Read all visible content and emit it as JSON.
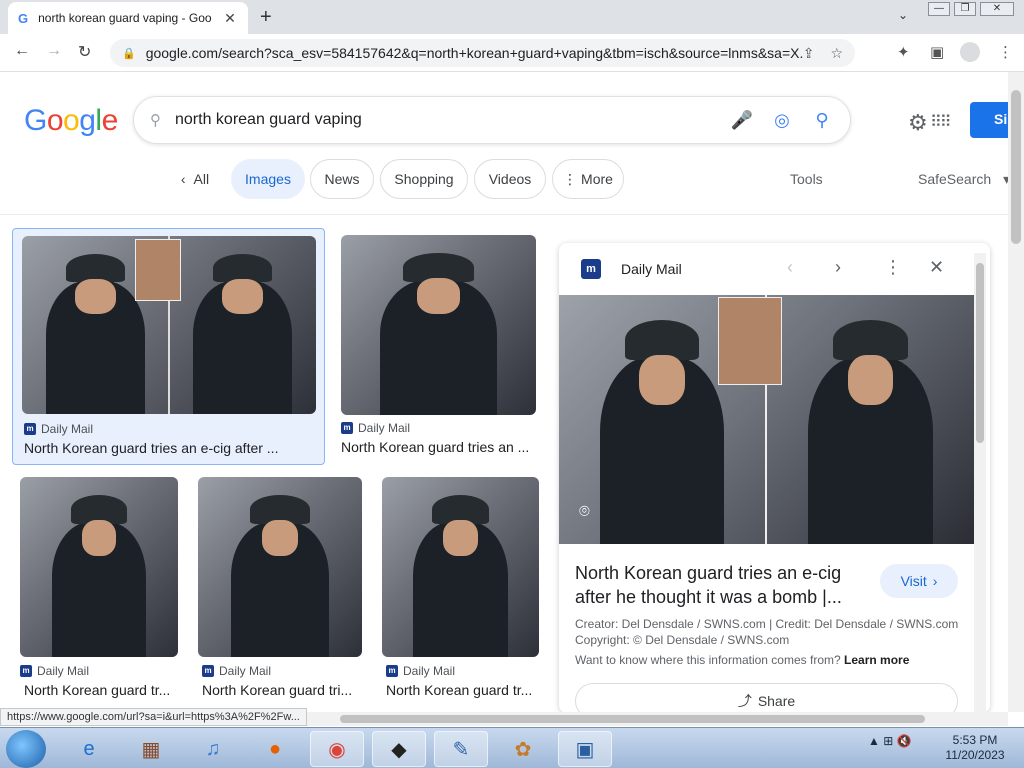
{
  "browser": {
    "tab_title": "north korean guard vaping - Goo",
    "tab_favicon": "G",
    "tab_close": "✕",
    "new_tab": "+",
    "tab_list": "⌄",
    "url": "google.com/search?sca_esv=584157642&q=north+korean+guard+vaping&tbm=isch&source=lnms&sa=X...",
    "status_url": "https://www.google.com/url?sa=i&url=https%3A%2F%2Fw...",
    "win_min": "—",
    "win_restore": "❐",
    "win_close": "✕"
  },
  "search": {
    "logo": "Google",
    "query": "north korean guard vaping",
    "signin": "Si",
    "search_icon": "🔍",
    "mic_icon": "🎙",
    "lens_icon": "◎"
  },
  "chips": {
    "all": "All",
    "images": "Images",
    "news": "News",
    "shopping": "Shopping",
    "videos": "Videos",
    "more": "More",
    "tools": "Tools",
    "safesearch": "SafeSearch"
  },
  "results": [
    {
      "source": "Daily Mail",
      "title": "North Korean guard tries an e-cig after ..."
    },
    {
      "source": "Daily Mail",
      "title": "North Korean guard tries an ..."
    },
    {
      "source": "Daily Mail",
      "title": "North Korean guard tr..."
    },
    {
      "source": "Daily Mail",
      "title": "North Korean guard tri..."
    },
    {
      "source": "Daily Mail",
      "title": "North Korean guard tr..."
    }
  ],
  "panel": {
    "source": "Daily Mail",
    "title": "North Korean guard tries an e-cig after he thought it was a bomb |...",
    "visit": "Visit",
    "credit_line": "Creator: Del Densdale / SWNS.com | Credit: Del Densdale / SWNS.com",
    "copyright_line": "Copyright: © Del Densdale / SWNS.com",
    "learn_prefix": "Want to know where this information comes from?",
    "learn_link": "Learn more",
    "share": "Share"
  },
  "taskbar": {
    "time": "5:53 PM",
    "date": "11/20/2023"
  },
  "colors": {
    "accent": "#1a73e8",
    "chip_active_bg": "#e8f0fe",
    "chip_active_fg": "#1967d2"
  }
}
